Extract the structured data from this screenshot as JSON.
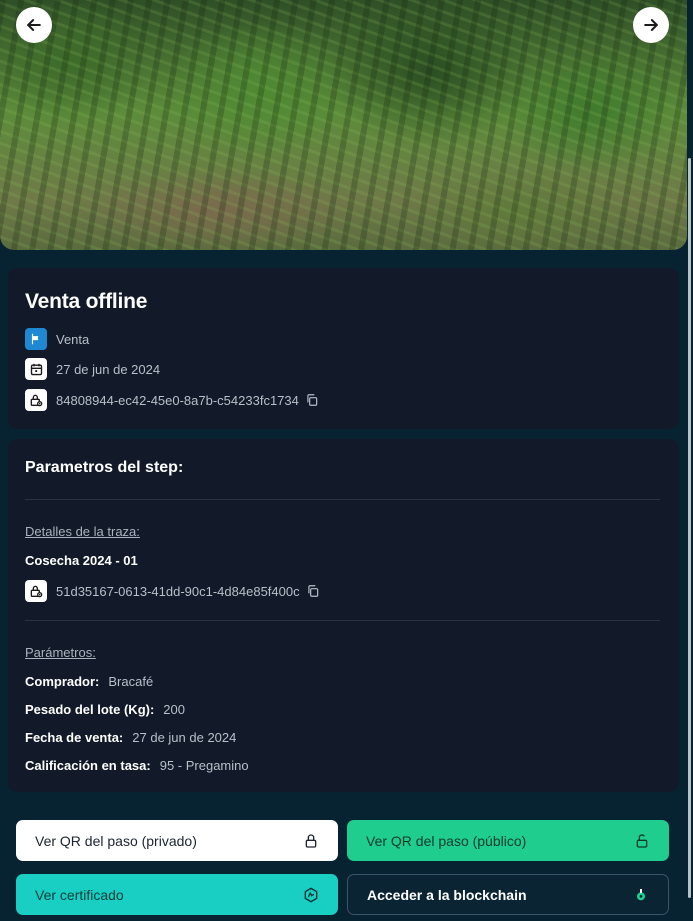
{
  "hero": {
    "prev_icon": "arrow-left-icon",
    "next_icon": "arrow-right-icon"
  },
  "step": {
    "title": "Venta offline",
    "type_label": "Venta",
    "date": "27 de jun de 2024",
    "id": "84808944-ec42-45e0-8a7b-c54233fc1734"
  },
  "params_card": {
    "heading": "Parametros del step:",
    "trace_details_label": "Detalles de la traza:",
    "trace_name": "Cosecha 2024 - 01",
    "trace_id": "51d35167-0613-41dd-90c1-4d84e85f400c",
    "params_label": "Parámetros:",
    "params": [
      {
        "key": "Comprador:",
        "value": "Bracafé"
      },
      {
        "key": "Pesado del lote (Kg):",
        "value": "200"
      },
      {
        "key": "Fecha de venta:",
        "value": "27 de jun de 2024"
      },
      {
        "key": "Calificación en tasa:",
        "value": "95 - Pregamino"
      }
    ]
  },
  "buttons": {
    "qr_private": "Ver QR del paso (privado)",
    "qr_public": "Ver QR del paso (público)",
    "certificate": "Ver certificado",
    "blockchain": "Acceder a la blockchain"
  },
  "colors": {
    "background": "#072231",
    "card": "#121a29",
    "green": "#1fce8e",
    "teal": "#19cfc3",
    "flag_blue": "#1e88d3"
  }
}
